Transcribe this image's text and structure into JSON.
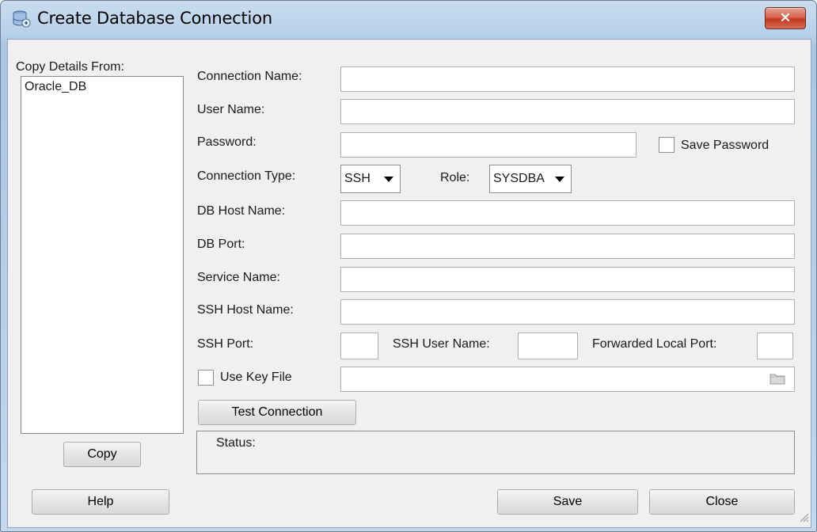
{
  "window": {
    "title": "Create Database Connection",
    "close_symbol": "✕",
    "icon": "database-icon"
  },
  "copy_panel": {
    "label": "Copy Details From:",
    "items": [
      "Oracle_DB"
    ],
    "copy_button": "Copy"
  },
  "form": {
    "connection_name_label": "Connection Name:",
    "connection_name_value": "",
    "user_name_label": "User Name:",
    "user_name_value": "",
    "password_label": "Password:",
    "password_value": "",
    "save_password_label": "Save Password",
    "save_password_checked": false,
    "connection_type_label": "Connection Type:",
    "connection_type_value": "SSH",
    "role_label": "Role:",
    "role_value": "SYSDBA",
    "db_host_name_label": "DB Host Name:",
    "db_host_name_value": "",
    "db_port_label": "DB Port:",
    "db_port_value": "",
    "service_name_label": "Service Name:",
    "service_name_value": "",
    "ssh_host_name_label": "SSH Host Name:",
    "ssh_host_name_value": "",
    "ssh_port_label": "SSH Port:",
    "ssh_port_value": "",
    "ssh_user_name_label": "SSH User Name:",
    "ssh_user_name_value": "",
    "forwarded_local_port_label": "Forwarded Local Port:",
    "forwarded_local_port_value": "",
    "use_key_file_label": "Use Key File",
    "use_key_file_checked": false,
    "key_file_value": "",
    "test_connection_button": "Test Connection",
    "status_label": "Status:"
  },
  "footer": {
    "help_button": "Help",
    "save_button": "Save",
    "close_button": "Close"
  }
}
